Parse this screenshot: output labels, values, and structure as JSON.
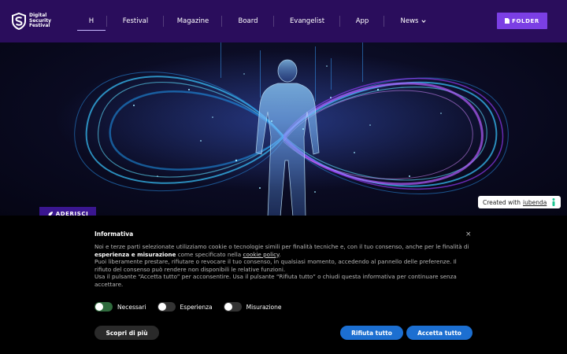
{
  "header": {
    "logo_lines": [
      "Digital",
      "Security",
      "Festival"
    ],
    "nav": [
      {
        "label": "H",
        "active": true
      },
      {
        "label": "Festival"
      },
      {
        "label": "Magazine"
      },
      {
        "label": "Board"
      },
      {
        "label": "Evangelist"
      },
      {
        "label": "App"
      },
      {
        "label": "News"
      }
    ],
    "folder_label": "FOLDER",
    "accent_color": "#7b3fe4"
  },
  "hero": {
    "join_label": "ADERISCI"
  },
  "iubenda": {
    "prefix": "Created with",
    "brand": "iubenda"
  },
  "cookie": {
    "title": "Informativa",
    "close": "×",
    "p1_pre": "Noi e terze parti selezionate utilizziamo cookie o tecnologie simili per finalità tecniche e, con il tuo consenso, anche per le finalità di",
    "p1_bold": "esperienza e misurazione",
    "p1_mid": "come specificato nella",
    "p1_link": "cookie policy",
    "p1_end": ".",
    "p2": "Puoi liberamente prestare, rifiutare o revocare il tuo consenso, in qualsiasi momento, accedendo al pannello delle preferenze. Il rifiuto del consenso può rendere non disponibili le relative funzioni.",
    "p3": "Usa il pulsante “Accetta tutto” per acconsentire. Usa il pulsante “Rifiuta tutto” o chiudi questa informativa per continuare senza accettare.",
    "toggles": [
      {
        "label": "Necessari",
        "on": true
      },
      {
        "label": "Esperienza",
        "on": false
      },
      {
        "label": "Misurazione",
        "on": false
      }
    ],
    "more_label": "Scopri di più",
    "reject_label": "Rifiuta tutto",
    "accept_label": "Accetta tutto",
    "button_color": "#1c6fd1"
  }
}
